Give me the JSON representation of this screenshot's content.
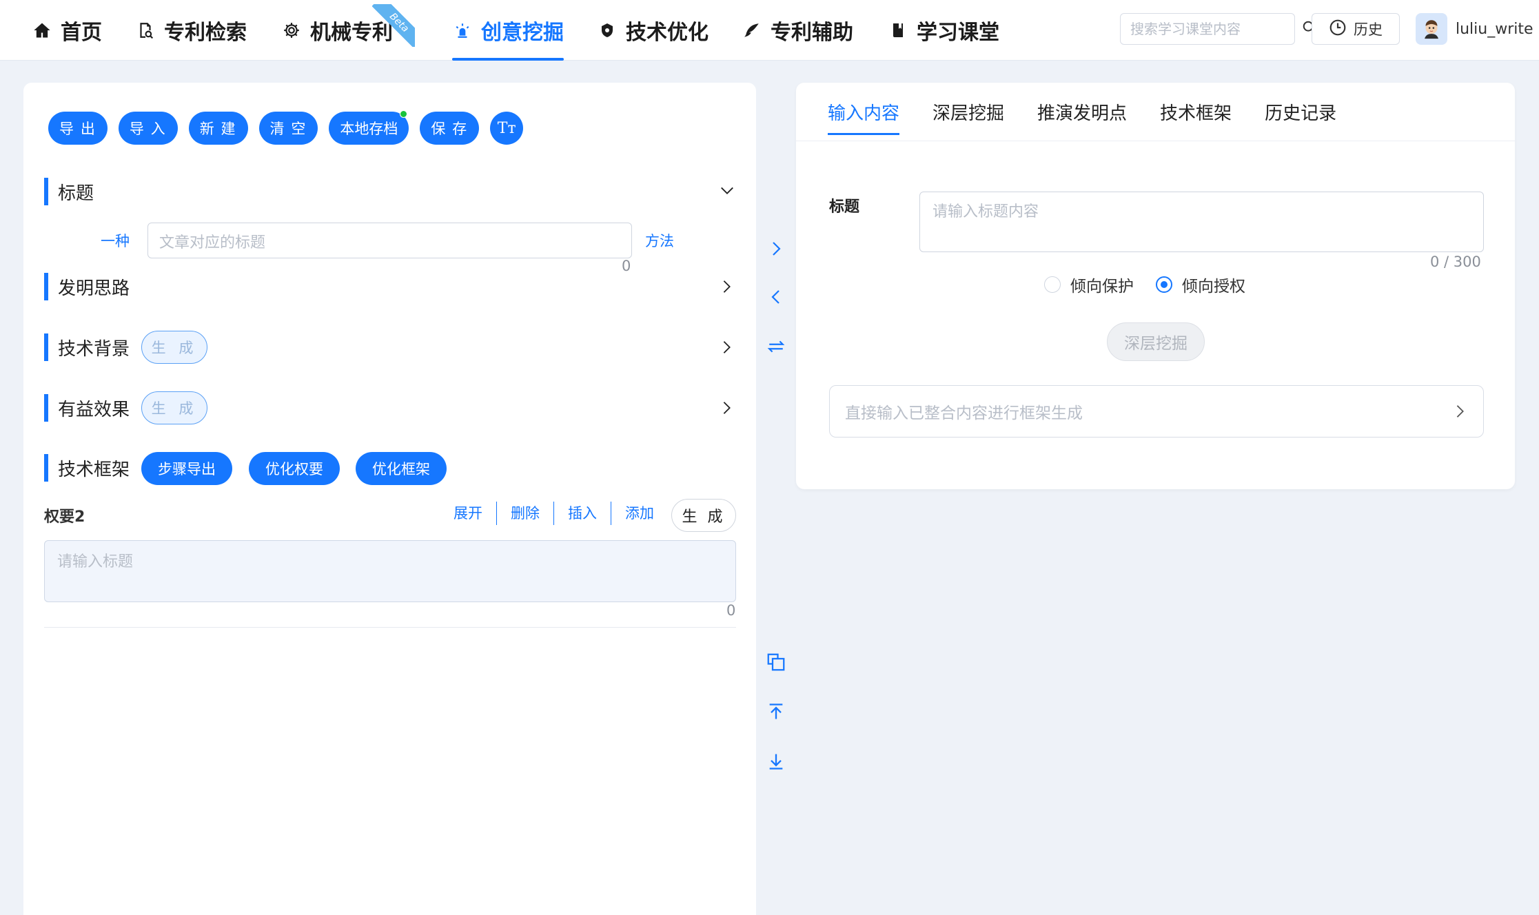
{
  "nav": {
    "items": [
      {
        "label": "首页",
        "icon": "home-icon"
      },
      {
        "label": "专利检索",
        "icon": "document-search-icon"
      },
      {
        "label": "机械专利",
        "icon": "gear-icon",
        "badge": "Beta"
      },
      {
        "label": "创意挖掘",
        "icon": "bulb-icon",
        "active": true
      },
      {
        "label": "技术优化",
        "icon": "shield-icon"
      },
      {
        "label": "专利辅助",
        "icon": "feather-icon"
      },
      {
        "label": "学习课堂",
        "icon": "book-icon"
      }
    ],
    "search_placeholder": "搜索学习课堂内容",
    "history_label": "历史",
    "username": "luliu_write"
  },
  "left": {
    "toolbar": [
      "导 出",
      "导 入",
      "新 建",
      "清 空",
      "本地存档",
      "保 存",
      "Tт"
    ],
    "sections": {
      "title": "标题",
      "title_prefix": "一种",
      "title_placeholder": "文章对应的标题",
      "title_suffix": "方法",
      "title_count": "0",
      "idea": "发明思路",
      "background": "技术背景",
      "effect": "有益效果",
      "generate": "生 成",
      "framework": "技术框架",
      "framework_buttons": [
        "步骤导出",
        "优化权要",
        "优化框架"
      ]
    },
    "claim": {
      "label": "权要2",
      "actions": [
        "展开",
        "删除",
        "插入",
        "添加"
      ],
      "generate": "生 成",
      "placeholder": "请输入标题",
      "count": "0"
    }
  },
  "right": {
    "tabs": [
      "输入内容",
      "深层挖掘",
      "推演发明点",
      "技术框架",
      "历史记录"
    ],
    "title_label": "标题",
    "title_placeholder": "请输入标题内容",
    "title_count": "0 / 300",
    "radio": [
      {
        "label": "倾向保护",
        "checked": false
      },
      {
        "label": "倾向授权",
        "checked": true
      }
    ],
    "deep_button": "深层挖掘",
    "direct_placeholder": "直接输入已整合内容进行框架生成"
  },
  "colors": {
    "accent": "#1677ff",
    "background": "#eef2f8",
    "badge_green": "#19c23b"
  }
}
